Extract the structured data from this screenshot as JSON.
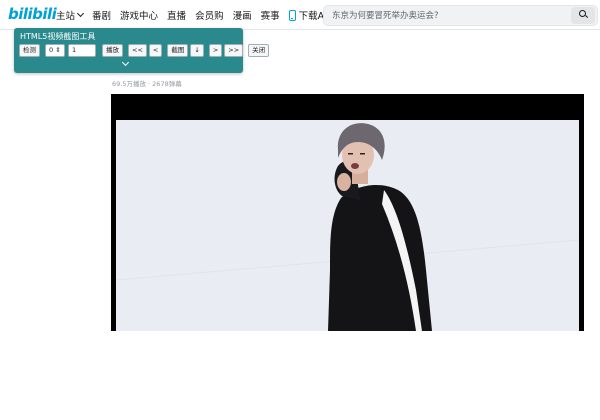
{
  "header": {
    "logo": "bilibili",
    "nav": [
      {
        "label": "主站",
        "has_dropdown": true
      },
      {
        "label": "番剧"
      },
      {
        "label": "游戏中心"
      },
      {
        "label": "直播"
      },
      {
        "label": "会员购"
      },
      {
        "label": "漫画"
      },
      {
        "label": "赛事"
      },
      {
        "label": "下载APP",
        "icon": "phone-icon"
      }
    ],
    "search": {
      "placeholder": "东京为何要冒死举办奥运会?",
      "icon": "search-icon"
    }
  },
  "tool": {
    "title": "HTML5视频截图工具",
    "detect_label": "检测",
    "select_value": "0 ⇕",
    "input_value": "1",
    "play_label": "播放",
    "rewind_fast_label": "<<",
    "rewind_label": "<",
    "capture_label": "截图",
    "download_label": "↓",
    "forward_label": ">",
    "forward_fast_label": ">>",
    "close_label": "关闭",
    "toggle_icon": "chevron-down-icon"
  },
  "video": {
    "stats": "69.5万播放 · 2678弹幕"
  },
  "colors": {
    "brand": "#00a1d6",
    "tool_bg": "#29898d",
    "player_bg": "#000000"
  }
}
